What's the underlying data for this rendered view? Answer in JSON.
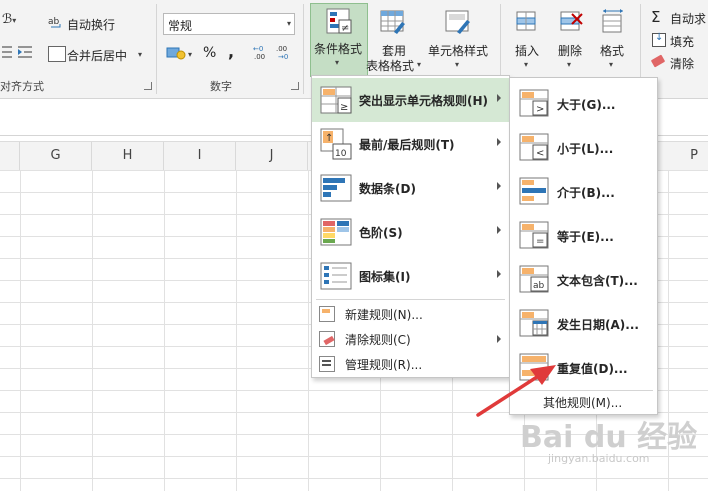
{
  "ribbon": {
    "wrap_text": "自动换行",
    "merge_center": "合并后居中",
    "align_group": "对齐方式",
    "number_format": "常规",
    "percent": "%",
    "comma": ",",
    "number_group": "数字",
    "cond_format": "条件格式",
    "table_format_1": "套用",
    "table_format_2": "表格格式",
    "cell_style": "单元格样式",
    "insert": "插入",
    "delete": "删除",
    "format": "格式",
    "autosum": "自动求",
    "fill": "填充",
    "clear": "清除"
  },
  "columns": [
    "G",
    "H",
    "I",
    "J",
    "P"
  ],
  "menu": {
    "items": [
      {
        "label": "突出显示单元格规则(H)",
        "icon": "highlight-rules-icon"
      },
      {
        "label": "最前/最后规则(T)",
        "icon": "top-bottom-icon"
      },
      {
        "label": "数据条(D)",
        "icon": "data-bars-icon"
      },
      {
        "label": "色阶(S)",
        "icon": "color-scales-icon"
      },
      {
        "label": "图标集(I)",
        "icon": "icon-sets-icon"
      }
    ],
    "small_items": [
      {
        "label": "新建规则(N)...",
        "icon": "new-rule-icon"
      },
      {
        "label": "清除规则(C)",
        "icon": "clear-rules-icon"
      },
      {
        "label": "管理规则(R)...",
        "icon": "manage-rules-icon"
      }
    ]
  },
  "submenu": {
    "items": [
      {
        "label": "大于(G)...",
        "icon": "greater-than-icon"
      },
      {
        "label": "小于(L)...",
        "icon": "less-than-icon"
      },
      {
        "label": "介于(B)...",
        "icon": "between-icon"
      },
      {
        "label": "等于(E)...",
        "icon": "equal-to-icon"
      },
      {
        "label": "文本包含(T)...",
        "icon": "text-contains-icon"
      },
      {
        "label": "发生日期(A)...",
        "icon": "date-occurring-icon"
      },
      {
        "label": "重复值(D)...",
        "icon": "duplicate-values-icon"
      }
    ],
    "more": "其他规则(M)..."
  },
  "watermark": {
    "text": "Bai du 经验",
    "url": "jingyan.baidu.com"
  },
  "colors": {
    "highlight": "#d5e8d4",
    "arrow": "#e03a3a",
    "accent": "#2e75b6"
  }
}
